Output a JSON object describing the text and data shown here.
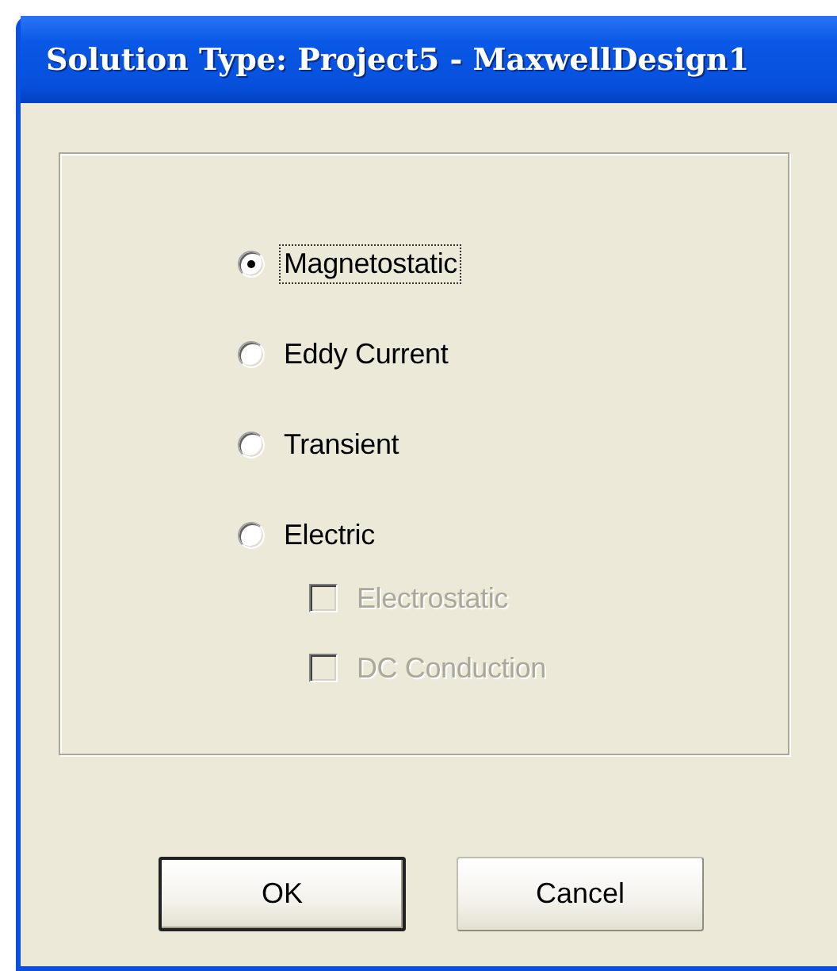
{
  "window": {
    "title": "Solution Type: Project5 - MaxwellDesign1"
  },
  "options": [
    {
      "kind": "radio",
      "label": "Magnetostatic",
      "selected": true,
      "focused": true
    },
    {
      "kind": "radio",
      "label": "Eddy Current",
      "selected": false,
      "focused": false
    },
    {
      "kind": "radio",
      "label": "Transient",
      "selected": false,
      "focused": false
    },
    {
      "kind": "radio",
      "label": "Electric",
      "selected": false,
      "focused": false,
      "children": [
        {
          "kind": "checkbox",
          "label": "Electrostatic",
          "checked": false,
          "disabled": true
        },
        {
          "kind": "checkbox",
          "label": "DC Conduction",
          "checked": false,
          "disabled": true
        }
      ]
    }
  ],
  "buttons": [
    {
      "label": "OK",
      "default": true
    },
    {
      "label": "Cancel",
      "default": false
    }
  ]
}
